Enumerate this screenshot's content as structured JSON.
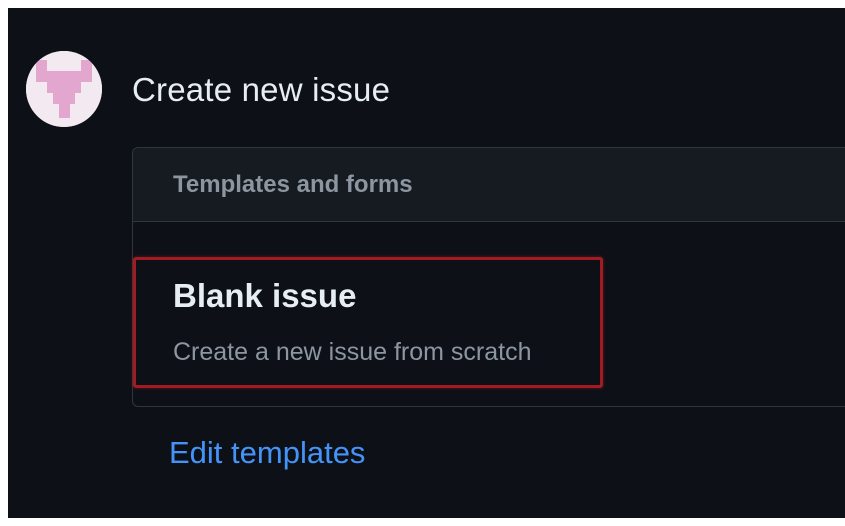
{
  "page": {
    "title": "Create new issue"
  },
  "templates_card": {
    "header": "Templates and forms",
    "blank_issue": {
      "title": "Blank issue",
      "description": "Create a new issue from scratch"
    }
  },
  "footer": {
    "edit_templates_label": "Edit templates"
  },
  "colors": {
    "background": "#0d1117",
    "header_background": "#161b22",
    "border": "#30363d",
    "link": "#4493f8",
    "highlight_outline": "#a01c22",
    "avatar_pattern": "#e2a6cf"
  },
  "icons": {
    "avatar": "identicon-avatar"
  }
}
